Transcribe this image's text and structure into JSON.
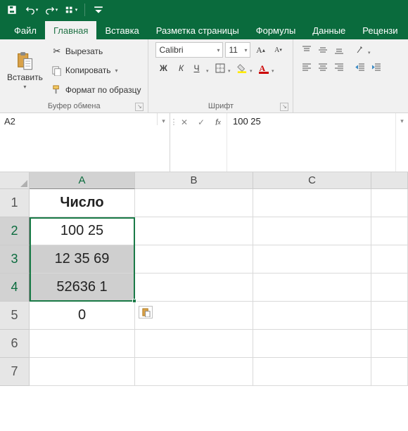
{
  "titlebar": {
    "save": "💾"
  },
  "tabs": {
    "file": "Файл",
    "home": "Главная",
    "insert": "Вставка",
    "layout": "Разметка страницы",
    "formulas": "Формулы",
    "data": "Данные",
    "review": "Рецензи"
  },
  "ribbon": {
    "clipboard": {
      "paste": "Вставить",
      "cut": "Вырезать",
      "copy": "Копировать",
      "formatPainter": "Формат по образцу",
      "groupLabel": "Буфер обмена"
    },
    "font": {
      "name": "Calibri",
      "size": "11",
      "groupLabel": "Шрифт",
      "bold": "Ж",
      "italic": "К",
      "underline": "Ч"
    },
    "alignment": {}
  },
  "namebox": "A2",
  "formula": "100 25",
  "columns": [
    "A",
    "B",
    "C"
  ],
  "rows": [
    "1",
    "2",
    "3",
    "4",
    "5",
    "6",
    "7"
  ],
  "cells": {
    "A1": "Число",
    "A2": "100 25",
    "A3": "12 35 69",
    "A4": "52636 1",
    "A5": "0"
  },
  "selection": {
    "start": "A2",
    "end": "A4"
  }
}
